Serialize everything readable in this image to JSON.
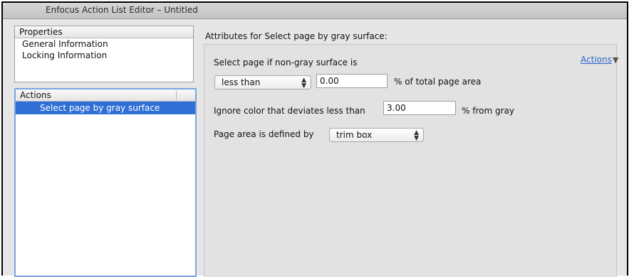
{
  "window": {
    "title": "Enfocus Action List Editor – Untitled"
  },
  "properties": {
    "header": "Properties",
    "items": [
      "General Information",
      "Locking Information"
    ]
  },
  "actions_list": {
    "header": "Actions",
    "items": [
      "Select page by gray surface"
    ],
    "selected_index": 0
  },
  "attributes": {
    "title": "Attributes for Select page by gray surface:",
    "actions_menu": {
      "label": "Actions",
      "icon": "triangle-down-icon"
    },
    "row1_label": "Select page if non-gray surface is",
    "comparison_select": {
      "value": "less than"
    },
    "area_value": "0.00",
    "area_suffix": "% of total page area",
    "ignore_label": "Ignore color that deviates less than",
    "deviation_value": "3.00",
    "deviation_suffix": "% from gray",
    "page_area_label": "Page area is defined by",
    "page_area_select": {
      "value": "trim box"
    }
  },
  "colors": {
    "selection": "#2f6fd6",
    "focus_border": "#7aa6dc",
    "link": "#2a62c9",
    "panel_bg": "#e2e2e2"
  }
}
